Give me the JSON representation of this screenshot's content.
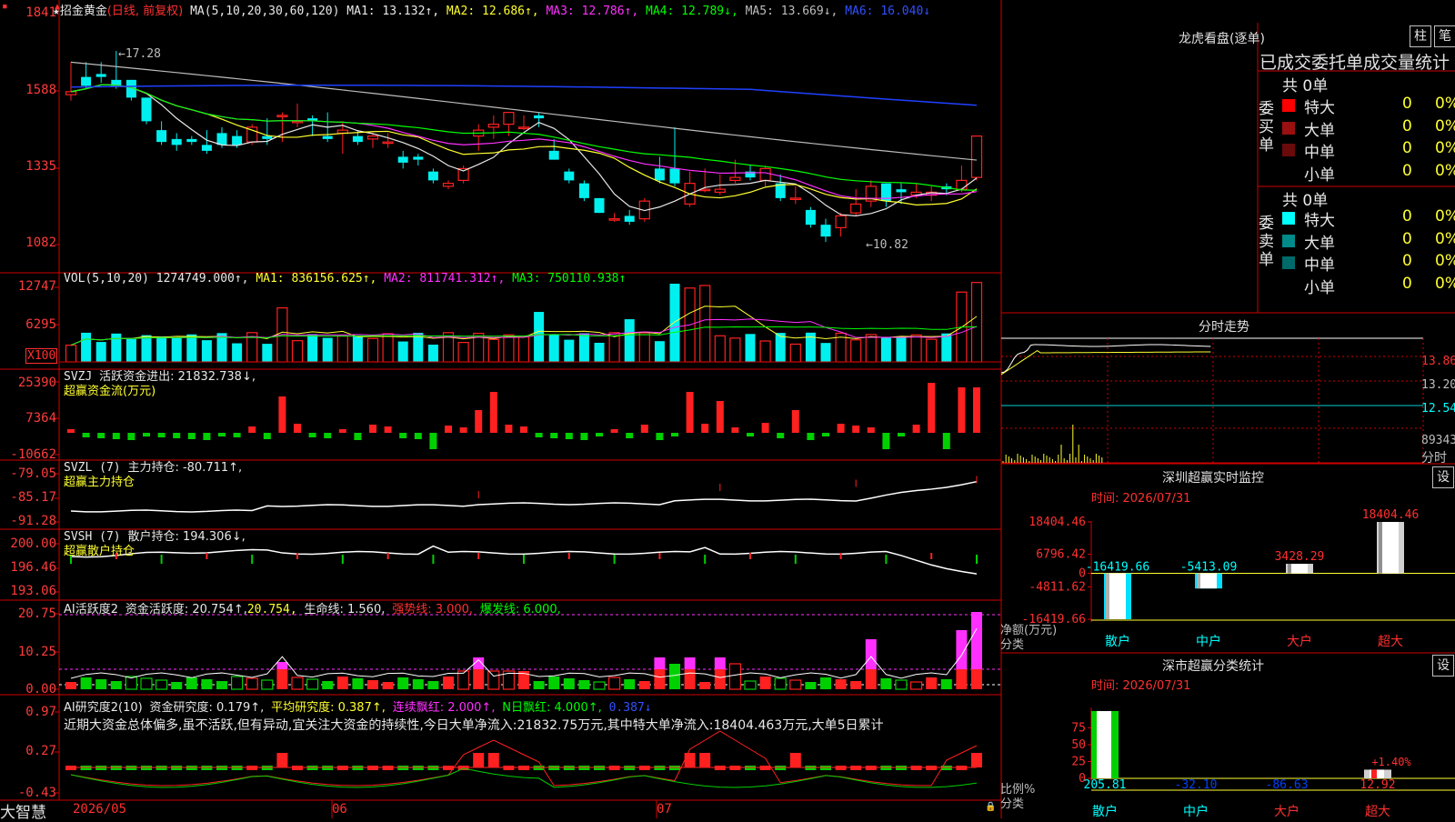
{
  "kline": {
    "header": {
      "star": "★",
      "name": "招金黄金",
      "mode": "(日线, 前复权)",
      "ma_def": "MA(5,10,20,30,60,120)",
      "ma1": "MA1: 13.132↑,",
      "ma2": "MA2: 12.686↑,",
      "ma3": "MA3: 12.786↑,",
      "ma4": "MA4: 12.789↓,",
      "ma5": "MA5: 13.669↓,",
      "ma6": "MA6: 16.040↓"
    },
    "yticks": [
      "1841",
      "1588",
      "1335",
      "1082"
    ],
    "high_label": "17.28",
    "low_label": "←10.82",
    "candles": [
      [
        15.8,
        16.6,
        15.9,
        16.9,
        15.6
      ],
      [
        16.4,
        16.6,
        16.1,
        16.9,
        16.0
      ],
      [
        16.5,
        16.7,
        16.4,
        16.9,
        16.2
      ],
      [
        16.3,
        17.28,
        16.1,
        17.28,
        16.0
      ],
      [
        16.3,
        16.1,
        15.7,
        16.3,
        15.6
      ],
      [
        15.7,
        15.4,
        14.9,
        15.7,
        14.8
      ],
      [
        14.6,
        14.9,
        14.2,
        14.9,
        14.1
      ],
      [
        14.3,
        14.4,
        14.1,
        14.5,
        13.9
      ],
      [
        14.3,
        14.4,
        14.2,
        14.4,
        14.1
      ],
      [
        14.1,
        14.2,
        13.9,
        14.6,
        13.8
      ],
      [
        14.5,
        14.7,
        14.1,
        14.7,
        14.0
      ],
      [
        14.4,
        14.3,
        14.1,
        14.6,
        14.0
      ],
      [
        14.2,
        14.4,
        14.7,
        14.8,
        14.1
      ],
      [
        14.4,
        14.7,
        14.3,
        15.0,
        14.1
      ],
      [
        15.1,
        14.5,
        15.1,
        15.2,
        14.2
      ],
      [
        14.9,
        15.5,
        14.9,
        15.5,
        14.7
      ],
      [
        15.0,
        14.5,
        14.9,
        15.1,
        14.4
      ],
      [
        14.4,
        14.9,
        14.3,
        15.2,
        14.2
      ],
      [
        14.5,
        14.3,
        14.6,
        14.9,
        13.8
      ],
      [
        14.4,
        14.4,
        14.2,
        14.6,
        14.1
      ],
      [
        14.3,
        14.1,
        14.4,
        14.5,
        14.0
      ],
      [
        14.2,
        14.4,
        14.2,
        14.5,
        14.0
      ],
      [
        13.7,
        13.5,
        13.5,
        13.9,
        13.3
      ],
      [
        13.7,
        13.5,
        13.6,
        13.8,
        13.4
      ],
      [
        13.2,
        13.0,
        12.9,
        13.3,
        12.8
      ],
      [
        12.7,
        12.7,
        12.8,
        12.9,
        12.6
      ],
      [
        12.9,
        13.2,
        13.3,
        13.4,
        12.8
      ],
      [
        14.4,
        14.3,
        14.6,
        14.8,
        13.9
      ],
      [
        14.7,
        14.5,
        14.8,
        15.1,
        14.3
      ],
      [
        14.8,
        14.9,
        15.2,
        15.2,
        14.4
      ],
      [
        14.7,
        15.1,
        14.7,
        15.1,
        14.6
      ],
      [
        15.1,
        14.9,
        15.0,
        15.2,
        14.7
      ],
      [
        13.9,
        14.1,
        13.6,
        14.3,
        13.6
      ],
      [
        13.2,
        13.0,
        12.9,
        13.3,
        12.8
      ],
      [
        12.8,
        12.5,
        12.3,
        12.9,
        12.2
      ],
      [
        12.3,
        12.0,
        11.8,
        12.3,
        11.8
      ],
      [
        11.6,
        11.7,
        11.6,
        11.8,
        11.5
      ],
      [
        11.7,
        11.6,
        11.5,
        11.9,
        11.4
      ],
      [
        11.6,
        12.0,
        12.2,
        12.3,
        11.5
      ],
      [
        13.3,
        13.0,
        12.9,
        13.7,
        12.8
      ],
      [
        13.3,
        13.0,
        12.8,
        14.7,
        12.7
      ],
      [
        12.1,
        12.3,
        12.8,
        13.2,
        12.0
      ],
      [
        12.6,
        13.1,
        12.6,
        13.3,
        12.5
      ],
      [
        12.5,
        13.0,
        12.6,
        13.1,
        12.4
      ],
      [
        12.9,
        13.3,
        13.0,
        13.6,
        12.8
      ],
      [
        13.2,
        13.1,
        13.0,
        13.4,
        12.9
      ],
      [
        12.9,
        13.2,
        13.3,
        13.4,
        12.7
      ],
      [
        12.8,
        12.7,
        12.3,
        13.1,
        12.2
      ],
      [
        12.3,
        12.6,
        12.3,
        12.7,
        12.1
      ],
      [
        11.9,
        11.5,
        11.4,
        12.0,
        11.3
      ],
      [
        11.4,
        11.5,
        11.0,
        11.6,
        10.82
      ],
      [
        11.3,
        11.4,
        11.7,
        11.8,
        11.0
      ],
      [
        11.8,
        12.1,
        12.1,
        12.6,
        11.7
      ],
      [
        12.2,
        12.5,
        12.7,
        12.9,
        12.0
      ],
      [
        12.8,
        12.6,
        12.2,
        12.8,
        12.0
      ],
      [
        12.6,
        12.5,
        12.5,
        12.8,
        12.1
      ],
      [
        12.4,
        12.7,
        12.5,
        12.8,
        12.3
      ],
      [
        12.4,
        12.4,
        12.5,
        12.7,
        12.2
      ],
      [
        12.7,
        12.5,
        12.6,
        12.8,
        12.4
      ],
      [
        12.6,
        13.0,
        12.9,
        13.4,
        12.5
      ],
      [
        13.0,
        13.2,
        14.4,
        14.4,
        12.9
      ]
    ]
  },
  "volume": {
    "header": {
      "def": "VOL(5,10,20)",
      "vol": "1274749.000↑,",
      "ma1": "MA1: 836156.625↑,",
      "ma2": "MA2: 811741.312↑,",
      "ma3": "MA3: 750110.938↑"
    },
    "yticks": [
      "12747",
      "6295"
    ],
    "unit": "X100"
  },
  "svzj": {
    "header": {
      "def": "SVZJ",
      "label": "活跃资金进出: 21832.738↓,",
      "sub": "超赢资金流(万元)"
    },
    "yticks": [
      "25390",
      "7364",
      "-10662"
    ]
  },
  "svzl": {
    "header": {
      "def": "SVZL (7)",
      "label": "主力持仓: -80.711↑,",
      "sub": "超赢主力持仓"
    },
    "yticks": [
      "-79.05",
      "-85.17",
      "-91.28"
    ]
  },
  "svsh": {
    "header": {
      "def": "SVSH (7)",
      "label": "散户持仓: 194.306↓,",
      "sub": "超赢散户持仓"
    },
    "yticks": [
      "200.00",
      "196.46",
      "193.06"
    ]
  },
  "ai1": {
    "header": {
      "def": "AI活跃度2",
      "a": "资金活跃度: 20.754↑,",
      "b": "20.754,",
      "c": "生命线: 1.560,",
      "d": "强势线: 3.000,",
      "e": "爆发线: 6.000,"
    },
    "yticks": [
      "20.75",
      "10.25",
      "0.00"
    ]
  },
  "ai2": {
    "header": {
      "def": "AI研究度2(10)",
      "a": "资金研究度: 0.179↑,",
      "b": "平均研究度: 0.387↑,",
      "c": "连续飘红: 2.000↑,",
      "d": "N日飘红: 4.000↑,",
      "e": "0.387↓"
    },
    "text": "近期大资金总体偏多,虽不活跃,但有异动,宜关注大资金的持续性,今日大单净流入:21832.75万元,其中特大单净流入:18404.463万元,大单5日累计",
    "yticks": [
      "0.97",
      "0.27",
      "-0.43"
    ]
  },
  "time_axis": {
    "corner": "大智慧",
    "labels": [
      "2026/05",
      "06",
      "07"
    ]
  },
  "longhu": {
    "title": "龙虎看盘(逐单)",
    "btn1": "柱",
    "btn2": "笔",
    "subtitle": "已成交委托单成交量统计",
    "buy_label": "委买单",
    "sell_label": "委卖单",
    "buy_total": "共 0单",
    "sell_total": "共 0单",
    "buy_rows": [
      {
        "name": "特大",
        "count": "0",
        "pct": "0%",
        "color": "#ff0000"
      },
      {
        "name": "大单",
        "count": "0",
        "pct": "0%",
        "color": "#9a1010"
      },
      {
        "name": "中单",
        "count": "0",
        "pct": "0%",
        "color": "#6a0a0a"
      },
      {
        "name": "小单",
        "count": "0",
        "pct": "0%",
        "color": "#000000"
      }
    ],
    "sell_rows": [
      {
        "name": "特大",
        "count": "0",
        "pct": "0%",
        "color": "#00ffff"
      },
      {
        "name": "大单",
        "count": "0",
        "pct": "0%",
        "color": "#008a8a"
      },
      {
        "name": "中单",
        "count": "0",
        "pct": "0%",
        "color": "#006a6a"
      },
      {
        "name": "小单",
        "count": "0",
        "pct": "0%",
        "color": "#000000"
      }
    ]
  },
  "fenshi": {
    "title": "分时走势",
    "yticks": [
      "13.86",
      "13.20",
      "12.54",
      "89343"
    ],
    "bottom": "分时"
  },
  "sz_monitor": {
    "title": "深圳超赢实时监控",
    "set_btn": "设",
    "time": "时间: 2026/07/31",
    "yticks": [
      "18404.46",
      "6796.42",
      "0",
      "-4811.62",
      "-16419.66"
    ],
    "ylabel1": "净额(万元)",
    "ylabel2": "分类",
    "chart_data": {
      "type": "bar",
      "categories": [
        "散户",
        "中户",
        "大户",
        "超大"
      ],
      "values": [
        -16419.66,
        -5413.09,
        3428.29,
        18404.46
      ],
      "value_labels": [
        "-16419.66",
        "-5413.09",
        "3428.29",
        "18404.46"
      ],
      "ylim": [
        -16419.66,
        18404.46
      ]
    }
  },
  "sz_class": {
    "title": "深市超赢分类统计",
    "set_btn": "设",
    "time": "时间: 2026/07/31",
    "yticks": [
      "75",
      "50",
      "25",
      "0"
    ],
    "ylabel1": "比例%",
    "ylabel2": "分类",
    "chart_data": {
      "type": "bar",
      "categories": [
        "散户",
        "中户",
        "大户",
        "超大"
      ],
      "values": [
        205.81,
        -32.1,
        -86.63,
        12.92
      ],
      "value_labels": [
        "205.81",
        "-32.10",
        "-86.63",
        "12.92"
      ],
      "annotation": "+1.40%",
      "ylim": [
        0,
        100
      ]
    }
  }
}
